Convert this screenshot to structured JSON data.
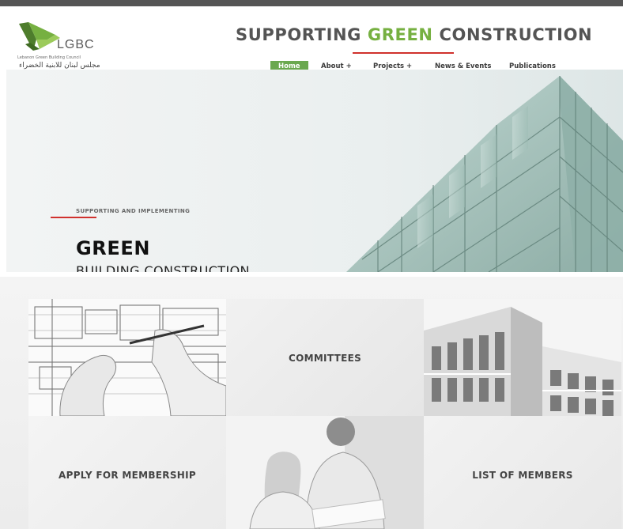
{
  "header": {
    "logo_text": "LGBC",
    "logo_subtitle": "Lebanon Green Building Council",
    "logo_arabic": "مجلس لبنان للابنية الخضراء",
    "tagline_part1": "SUPPORTING ",
    "tagline_green": "GREEN",
    "tagline_part2": " CONSTRUCTION"
  },
  "nav": {
    "items": [
      {
        "label": "Home"
      },
      {
        "label": "About  +"
      },
      {
        "label": "Projects  +"
      },
      {
        "label": "News & Events"
      },
      {
        "label": "Publications"
      }
    ]
  },
  "hero": {
    "subtitle": "SUPPORTING AND IMPLEMENTING",
    "title": "GREEN",
    "title2": "BUILDING CONSTRUCTION"
  },
  "tiles": {
    "committees": "COMMITTEES",
    "apply": "APPLY FOR MEMBERSHIP",
    "members": "LIST OF MEMBERS"
  },
  "colors": {
    "accent_green": "#76b041",
    "nav_active": "#6aa84f",
    "accent_red": "#d0312d",
    "text_dark": "#545454"
  }
}
